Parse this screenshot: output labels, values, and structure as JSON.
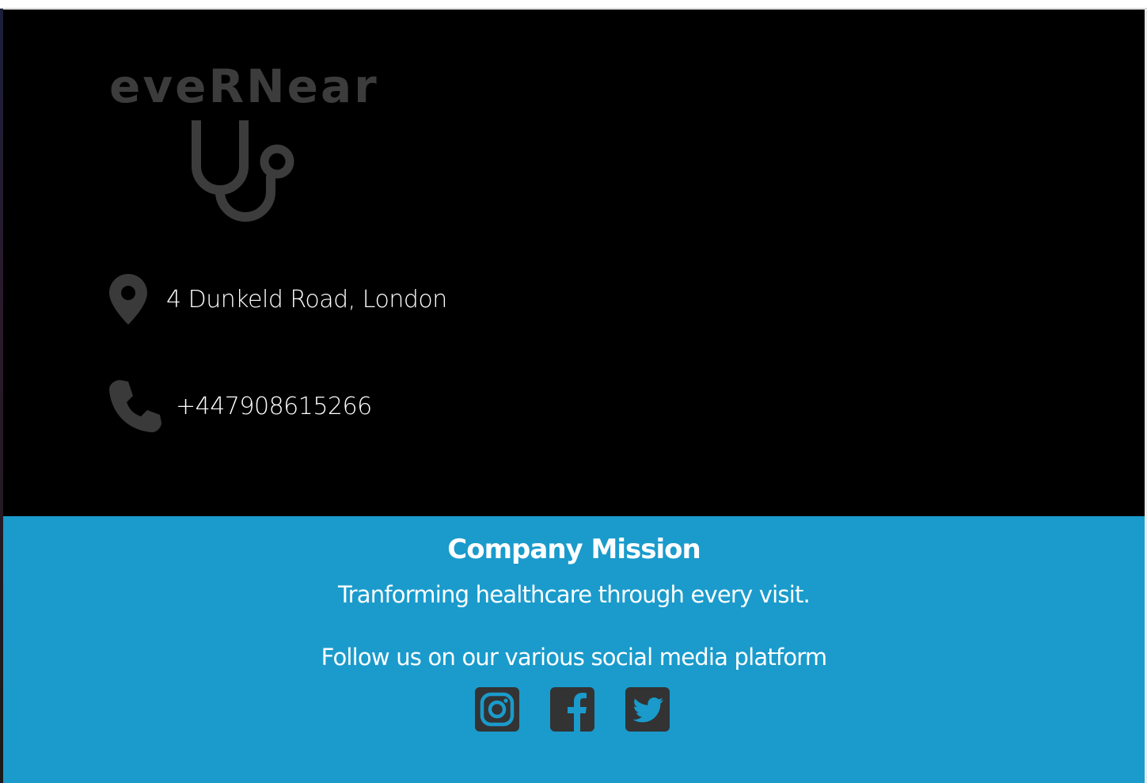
{
  "brand": {
    "name": "eveRNear",
    "logo_icon": "stethoscope-icon",
    "logo_color": "#3c3c3c"
  },
  "contact": {
    "address": {
      "icon": "map-pin-icon",
      "text": "4 Dunkeld Road, London"
    },
    "phone": {
      "icon": "phone-icon",
      "text": "+447908615266"
    }
  },
  "mission": {
    "title": "Company Mission",
    "statement": "Tranforming healthcare through every visit.",
    "follow_text": "Follow us on our various social media platform"
  },
  "social": [
    {
      "name": "instagram",
      "icon": "instagram-icon"
    },
    {
      "name": "facebook",
      "icon": "facebook-icon"
    },
    {
      "name": "twitter",
      "icon": "twitter-icon"
    }
  ],
  "colors": {
    "contact_bg": "#000000",
    "mission_bg": "#1a9bcc",
    "icon_dark": "#333333",
    "text_light": "#ffffff"
  }
}
